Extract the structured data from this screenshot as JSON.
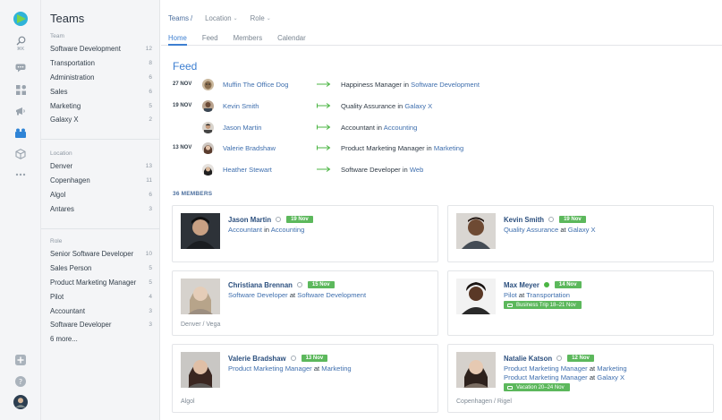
{
  "rail": {
    "search_caption": "⌘K"
  },
  "sidebar": {
    "title": "Teams",
    "team_heading": "Team",
    "teams": [
      {
        "label": "Software Development",
        "count": "12"
      },
      {
        "label": "Transportation",
        "count": "8"
      },
      {
        "label": "Administration",
        "count": "6"
      },
      {
        "label": "Sales",
        "count": "6"
      },
      {
        "label": "Marketing",
        "count": "5"
      },
      {
        "label": "Galaxy X",
        "count": "2"
      }
    ],
    "location_heading": "Location",
    "locations": [
      {
        "label": "Denver",
        "count": "13"
      },
      {
        "label": "Copenhagen",
        "count": "11"
      },
      {
        "label": "Algol",
        "count": "6"
      },
      {
        "label": "Antares",
        "count": "3"
      }
    ],
    "role_heading": "Role",
    "roles": [
      {
        "label": "Senior Software Developer",
        "count": "10"
      },
      {
        "label": "Sales Person",
        "count": "5"
      },
      {
        "label": "Product Marketing Manager",
        "count": "5"
      },
      {
        "label": "Pilot",
        "count": "4"
      },
      {
        "label": "Accountant",
        "count": "3"
      },
      {
        "label": "Software Developer",
        "count": "3"
      }
    ],
    "more_label": "6 more..."
  },
  "header": {
    "breadcrumb_root": "Teams",
    "breadcrumb_sep": "/",
    "location_dropdown": "Location",
    "role_dropdown": "Role",
    "tabs": [
      "Home",
      "Feed",
      "Members",
      "Calendar"
    ],
    "active_tab": "Home"
  },
  "feed": {
    "title": "Feed",
    "rows": [
      {
        "date": "27 NOV",
        "name": "Muffin The Office Dog",
        "role": "Happiness Manager",
        "connector": "in",
        "team": "Software Development"
      },
      {
        "date": "19 NOV",
        "name": "Kevin Smith",
        "role": "Quality Assurance",
        "connector": "in",
        "team": "Galaxy X"
      },
      {
        "date": "",
        "name": "Jason Martin",
        "role": "Accountant",
        "connector": "in",
        "team": "Accounting"
      },
      {
        "date": "13 NOV",
        "name": "Valerie Bradshaw",
        "role": "Product Marketing Manager",
        "connector": "in",
        "team": "Marketing"
      },
      {
        "date": "",
        "name": "Heather Stewart",
        "role": "Software Developer",
        "connector": "in",
        "team": "Web"
      }
    ]
  },
  "members": {
    "label": "36 MEMBERS",
    "cards": [
      {
        "name": "Jason Martin",
        "online": false,
        "badge": "19 Nov",
        "lines": [
          {
            "role": "Accountant",
            "connector": "in",
            "team": "Accounting"
          }
        ],
        "trip": "",
        "location": ""
      },
      {
        "name": "Kevin Smith",
        "online": false,
        "badge": "19 Nov",
        "lines": [
          {
            "role": "Quality Assurance",
            "connector": "at",
            "team": "Galaxy X"
          }
        ],
        "trip": "",
        "location": ""
      },
      {
        "name": "Christiana Brennan",
        "online": false,
        "badge": "15 Nov",
        "lines": [
          {
            "role": "Software Developer",
            "connector": "at",
            "team": "Software Development"
          }
        ],
        "trip": "",
        "location": "Denver / Vega"
      },
      {
        "name": "Max Meyer",
        "online": true,
        "badge": "14 Nov",
        "lines": [
          {
            "role": "Pilot",
            "connector": "at",
            "team": "Transportation"
          }
        ],
        "trip": "Business Trip 18–21 Nov",
        "location": ""
      },
      {
        "name": "Valerie Bradshaw",
        "online": false,
        "badge": "13 Nov",
        "lines": [
          {
            "role": "Product Marketing Manager",
            "connector": "at",
            "team": "Marketing"
          }
        ],
        "trip": "",
        "location": "Algol"
      },
      {
        "name": "Natalie Katson",
        "online": false,
        "badge": "12 Nov",
        "lines": [
          {
            "role": "Product Marketing Manager",
            "connector": "at",
            "team": "Marketing"
          },
          {
            "role": "Product Marketing Manager",
            "connector": "at",
            "team": "Galaxy X"
          }
        ],
        "trip": "Vacation 20–24 Nov",
        "location": "Copenhagen / Rigel"
      }
    ]
  },
  "colors": {
    "accent": "#3d7fd1",
    "link": "#3f6fae",
    "badge_green": "#5cb85c",
    "online": "#4bb543"
  }
}
